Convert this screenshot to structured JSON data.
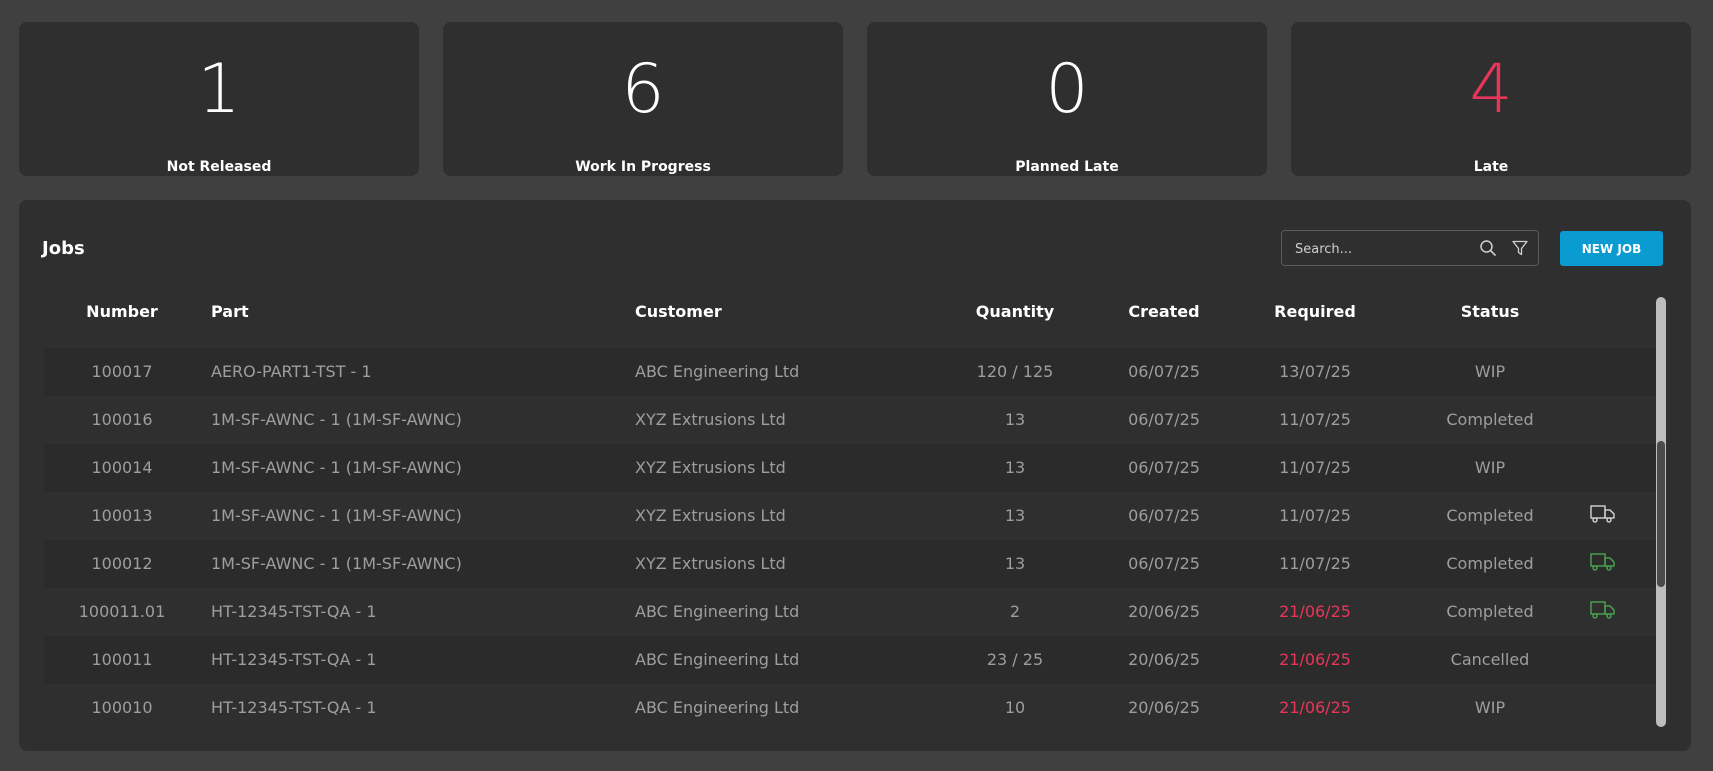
{
  "stats": [
    {
      "value": "1",
      "label": "Not Released",
      "color": "#ffffff"
    },
    {
      "value": "6",
      "label": "Work In Progress",
      "color": "#ffffff"
    },
    {
      "value": "0",
      "label": "Planned Late",
      "color": "#ffffff"
    },
    {
      "value": "4",
      "label": "Late",
      "color": "#e8355a"
    }
  ],
  "jobs": {
    "title": "Jobs",
    "search": {
      "placeholder": "Search..."
    },
    "new_job_label": "NEW JOB",
    "columns": {
      "number": "Number",
      "part": "Part",
      "customer": "Customer",
      "quantity": "Quantity",
      "created": "Created",
      "required": "Required",
      "status": "Status"
    },
    "rows": [
      {
        "number": "100017",
        "part": "AERO-PART1-TST - 1",
        "customer": "ABC Engineering Ltd",
        "quantity": "120 / 125",
        "created": "06/07/25",
        "required": "13/07/25",
        "status": "WIP",
        "late": false,
        "delivery_icon": null
      },
      {
        "number": "100016",
        "part": "1M-SF-AWNC - 1 (1M-SF-AWNC)",
        "customer": "XYZ Extrusions Ltd",
        "quantity": "13",
        "created": "06/07/25",
        "required": "11/07/25",
        "status": "Completed",
        "late": false,
        "delivery_icon": null
      },
      {
        "number": "100014",
        "part": "1M-SF-AWNC - 1 (1M-SF-AWNC)",
        "customer": "XYZ Extrusions Ltd",
        "quantity": "13",
        "created": "06/07/25",
        "required": "11/07/25",
        "status": "WIP",
        "late": false,
        "delivery_icon": null
      },
      {
        "number": "100013",
        "part": "1M-SF-AWNC - 1 (1M-SF-AWNC)",
        "customer": "XYZ Extrusions Ltd",
        "quantity": "13",
        "created": "06/07/25",
        "required": "11/07/25",
        "status": "Completed",
        "late": false,
        "delivery_icon": "white"
      },
      {
        "number": "100012",
        "part": "1M-SF-AWNC - 1 (1M-SF-AWNC)",
        "customer": "XYZ Extrusions Ltd",
        "quantity": "13",
        "created": "06/07/25",
        "required": "11/07/25",
        "status": "Completed",
        "late": false,
        "delivery_icon": "green"
      },
      {
        "number": "100011.01",
        "part": "HT-12345-TST-QA - 1",
        "customer": "ABC Engineering Ltd",
        "quantity": "2",
        "created": "20/06/25",
        "required": "21/06/25",
        "status": "Completed",
        "late": true,
        "delivery_icon": "green"
      },
      {
        "number": "100011",
        "part": "HT-12345-TST-QA - 1",
        "customer": "ABC Engineering Ltd",
        "quantity": "23 / 25",
        "created": "20/06/25",
        "required": "21/06/25",
        "status": "Cancelled",
        "late": true,
        "delivery_icon": null
      },
      {
        "number": "100010",
        "part": "HT-12345-TST-QA - 1",
        "customer": "ABC Engineering Ltd",
        "quantity": "10",
        "created": "20/06/25",
        "required": "21/06/25",
        "status": "WIP",
        "late": true,
        "delivery_icon": null
      }
    ]
  },
  "colors": {
    "accent": "#0a9bd0",
    "late": "#e8355a",
    "delivered": "#4caf50",
    "background": "#404040",
    "card": "#2f2f2f"
  },
  "icons": {
    "search": "search-icon",
    "filter": "filter-icon",
    "delivery": "delivery-truck-icon"
  }
}
